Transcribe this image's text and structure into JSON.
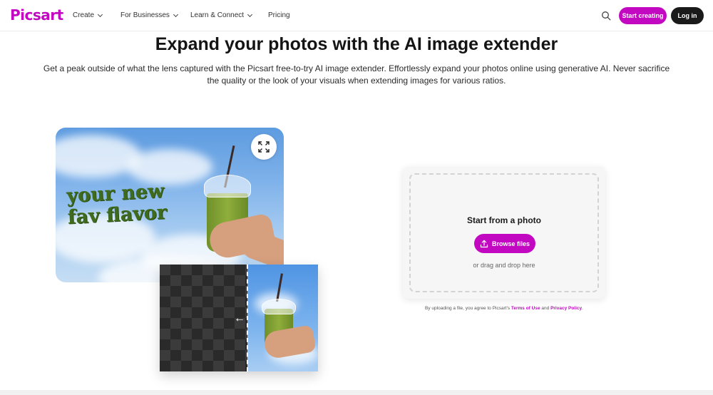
{
  "nav": {
    "logo": "Picsart",
    "items": [
      {
        "label": "Create",
        "has_dropdown": true
      },
      {
        "label": "For Businesses",
        "has_dropdown": true
      },
      {
        "label": "Learn & Connect",
        "has_dropdown": true
      },
      {
        "label": "Pricing",
        "has_dropdown": false
      }
    ],
    "search_icon": "search-icon",
    "start_label": "Start creating",
    "login_label": "Log in"
  },
  "hero": {
    "title": "Expand your photos with the AI image extender",
    "subtitle": "Get a peak outside of what the lens captured with the Picsart free-to-try AI image extender. Effortlessly expand your photos online using generative AI. Never sacrifice the quality or the look of your visuals when extending images for various ratios."
  },
  "showcase": {
    "tagline_line1": "your new",
    "tagline_line2": "fav flavor",
    "expand_icon": "expand-icon",
    "arrow_icon": "arrow-left-icon"
  },
  "upload": {
    "title": "Start from a photo",
    "browse_label": "Browse files",
    "drag_text": "or drag and drop here",
    "terms_prefix": "By uploading a file, you agree to Picsart's",
    "terms_link": "Terms of Use",
    "terms_and": "and",
    "privacy_link": "Privacy Policy",
    "terms_suffix": "."
  },
  "colors": {
    "brand": "#c209c1",
    "dark": "#1a1a1a"
  }
}
